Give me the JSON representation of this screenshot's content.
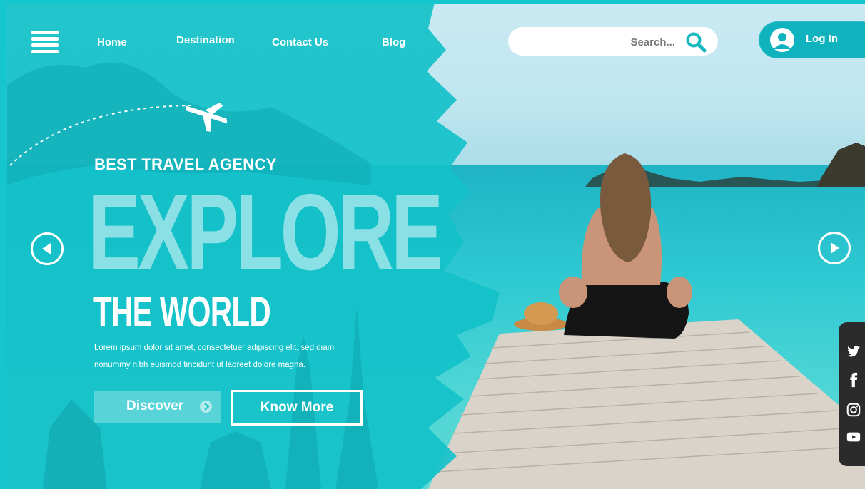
{
  "nav": {
    "menu_icon": "hamburger-menu-icon",
    "links": [
      "Home",
      "Destination",
      "Contact Us",
      "Blog"
    ]
  },
  "search": {
    "placeholder": "Search...",
    "icon": "search-icon"
  },
  "login": {
    "label": "Log In",
    "icon": "user-avatar-icon"
  },
  "hero": {
    "eyebrow": "BEST TRAVEL AGENCY",
    "headline": "EXPLORE",
    "subheadline": "THE WORLD",
    "body_line1": "Lorem ipsum dolor sit amet, consectetuer adipiscing elit, sed diam",
    "body_line2": "nonummy nibh euismod tincidunt ut laoreet dolore magna."
  },
  "buttons": {
    "discover": "Discover",
    "know_more": "Know More"
  },
  "slider": {
    "prev_icon": "arrow-left-icon",
    "next_icon": "arrow-right-icon"
  },
  "social": [
    "twitter-icon",
    "facebook-icon",
    "instagram-icon",
    "youtube-icon"
  ],
  "colors": {
    "accent": "#13c3cc",
    "dark": "#2b2b2b",
    "white": "#ffffff"
  }
}
